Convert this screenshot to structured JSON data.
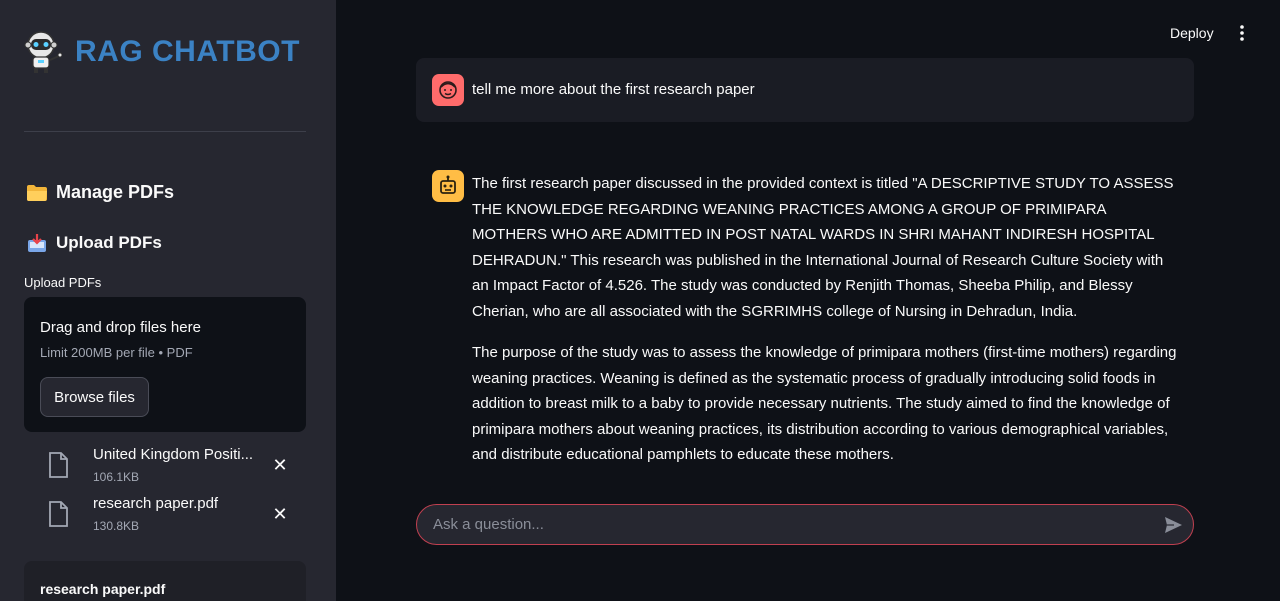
{
  "sidebar": {
    "title": "RAG CHATBOT",
    "manage_heading": "Manage PDFs",
    "upload_heading": "Upload PDFs",
    "upload_label": "Upload PDFs",
    "dropzone": {
      "title": "Drag and drop files here",
      "limit": "Limit 200MB per file • PDF",
      "browse_label": "Browse files"
    },
    "files": [
      {
        "name": "United Kingdom Positi...",
        "size": "106.1KB"
      },
      {
        "name": "research paper.pdf",
        "size": "130.8KB"
      }
    ],
    "preview_title": "research paper.pdf"
  },
  "header": {
    "deploy_label": "Deploy"
  },
  "chat": {
    "user_message": "tell me more about the first research paper",
    "bot_paragraphs": [
      "The first research paper discussed in the provided context is titled \"A DESCRIPTIVE STUDY TO ASSESS THE KNOWLEDGE REGARDING WEANING PRACTICES AMONG A GROUP OF PRIMIPARA MOTHERS WHO ARE ADMITTED IN POST NATAL WARDS IN SHRI MAHANT INDIRESH HOSPITAL DEHRADUN.\" This research was published in the International Journal of Research Culture Society with an Impact Factor of 4.526. The study was conducted by Renjith Thomas, Sheeba Philip, and Blessy Cherian, who are all associated with the SGRRIMHS college of Nursing in Dehradun, India.",
      "The purpose of the study was to assess the knowledge of primipara mothers (first-time mothers) regarding weaning practices. Weaning is defined as the systematic process of gradually introducing solid foods in addition to breast milk to a baby to provide necessary nutrients. The study aimed to find the knowledge of primipara mothers about weaning practices, its distribution according to various demographical variables, and distribute educational pamphlets to educate these mothers."
    ],
    "input_placeholder": "Ask a question..."
  },
  "icons": {
    "brand": "robot-icon",
    "manage": "folder-icon",
    "upload": "inbox-tray-icon",
    "file": "file-icon",
    "close": "close-icon",
    "menu": "vertical-dots-icon",
    "send": "send-icon",
    "user_avatar": "face-icon",
    "bot_avatar": "robot-face-icon"
  },
  "colors": {
    "brand_title": "#3b82c4",
    "user_avatar": "#ff6b6b",
    "bot_avatar": "#ffbd45",
    "input_border": "#c04050"
  }
}
